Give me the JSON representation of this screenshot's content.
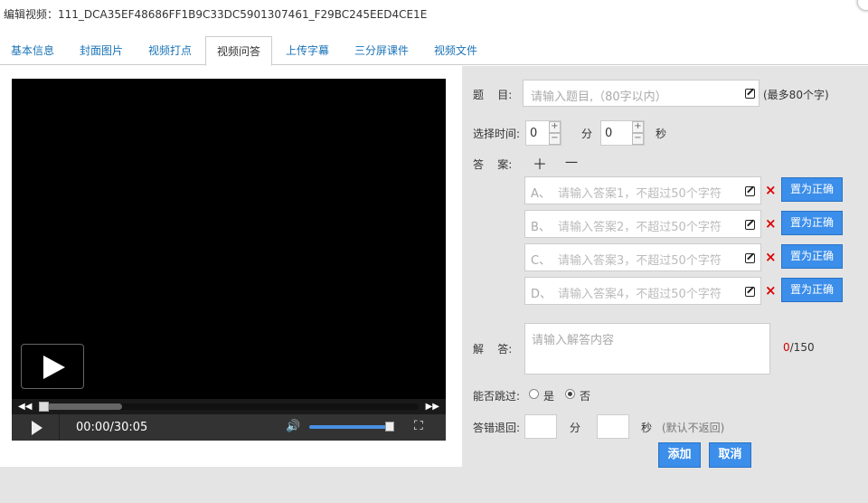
{
  "window": {
    "title": "编辑视频：111_DCA35EF48686FF1B9C33DC5901307461_F29BC245EED4CE1E"
  },
  "tabs": [
    {
      "label": "基本信息"
    },
    {
      "label": "封面图片"
    },
    {
      "label": "视频打点"
    },
    {
      "label": "视频问答"
    },
    {
      "label": "上传字幕"
    },
    {
      "label": "三分屏课件"
    },
    {
      "label": "视频文件"
    }
  ],
  "active_tab": "视频问答",
  "player": {
    "time": "00:00/30:05",
    "progress_fraction": 0.0,
    "buffered_fraction": 0.22,
    "volume_fraction": 1.0
  },
  "form": {
    "question_label": "题    目:",
    "question_placeholder": "请输入题目,（80字以内）",
    "question_hint": "(最多80个字)",
    "time_label": "选择时间:",
    "minutes_value": "0",
    "minutes_unit": "分",
    "seconds_value": "0",
    "seconds_unit": "秒",
    "spin_plus": "+",
    "spin_minus": "−",
    "answers_label": "答    案:",
    "add_symbol": "＋",
    "remove_symbol": "一",
    "answers": [
      {
        "letter": "A、",
        "placeholder": "请输入答案1，不超过50个字符"
      },
      {
        "letter": "B、",
        "placeholder": "请输入答案2，不超过50个字符"
      },
      {
        "letter": "C、",
        "placeholder": "请输入答案3，不超过50个字符"
      },
      {
        "letter": "D、",
        "placeholder": "请输入答案4，不超过50个字符"
      }
    ],
    "set_correct_label": "置为正确",
    "delete_symbol": "×",
    "explanation_label": "解    答:",
    "explanation_placeholder": "请输入解答内容",
    "explanation_count": "0",
    "explanation_max": "/150",
    "skip_label": "能否跳过:",
    "skip_yes": "是",
    "skip_no": "否",
    "rewind_label": "答错退回:",
    "rewind_min_unit": "分",
    "rewind_sec_unit": "秒",
    "rewind_hint": "(默认不返回)",
    "add_button": "添加",
    "cancel_button": "取消"
  },
  "colors": {
    "accent": "#3b8eea",
    "tab_link": "#1a73b8",
    "count_red": "#d00000"
  }
}
